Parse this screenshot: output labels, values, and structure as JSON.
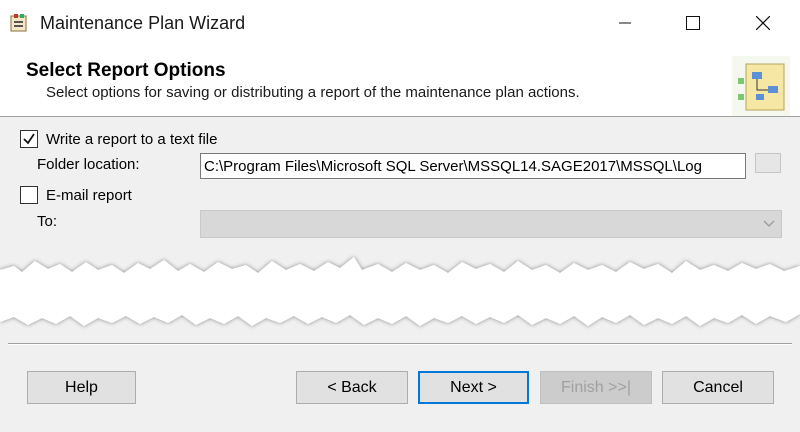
{
  "window": {
    "title": "Maintenance Plan Wizard",
    "controls": {
      "minimize": "minimize",
      "maximize": "maximize",
      "close": "close"
    }
  },
  "header": {
    "title": "Select Report Options",
    "subtitle": "Select options for saving or distributing a report of the maintenance plan actions."
  },
  "options": {
    "write_report": {
      "label": "Write a report to a text file",
      "checked": true
    },
    "folder_location": {
      "label": "Folder location:",
      "value": "C:\\Program Files\\Microsoft SQL Server\\MSSQL14.SAGE2017\\MSSQL\\Log"
    },
    "email_report": {
      "label": "E-mail report",
      "checked": false
    },
    "to": {
      "label": "To:",
      "value": ""
    }
  },
  "buttons": {
    "help": "Help",
    "back": "< Back",
    "next": "Next >",
    "finish": "Finish >>|",
    "cancel": "Cancel"
  },
  "colors": {
    "focus_accent": "#0078d7",
    "button_face": "#e1e1e1",
    "content_bg": "#f0f0f0"
  }
}
